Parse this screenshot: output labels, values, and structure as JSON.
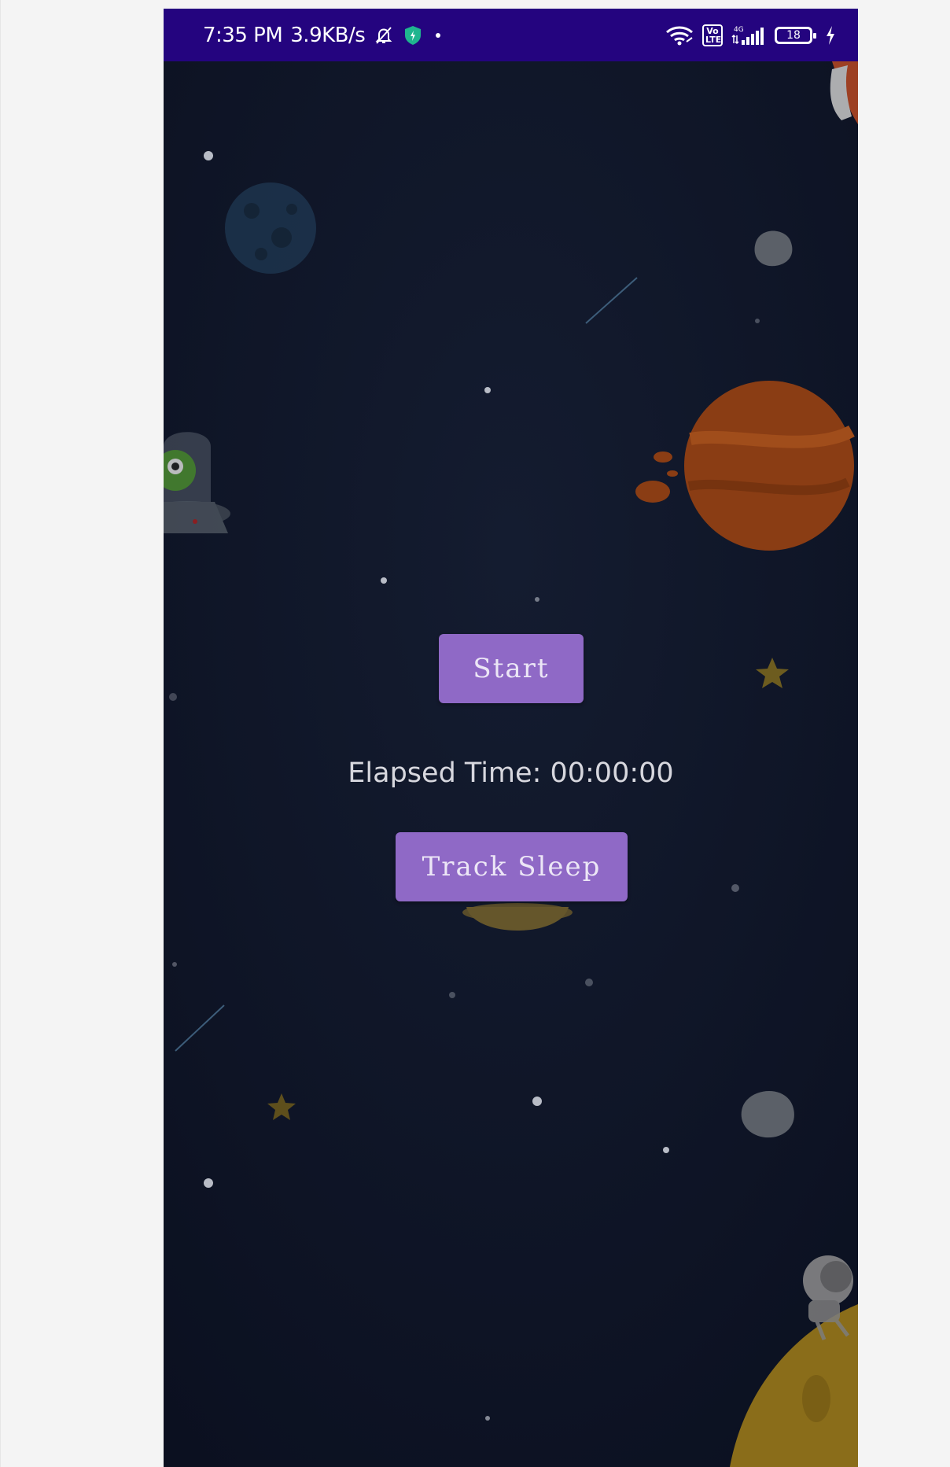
{
  "status_bar": {
    "time": "7:35 PM",
    "speed": "3.9KB/s",
    "network_label": "4G",
    "volte_label": "Vo\nLTE",
    "battery_level": "18",
    "colors": {
      "background": "#24047f",
      "shield": "#1fb58f"
    },
    "icons": [
      "mute-bell-icon",
      "shield-icon",
      "dot-icon",
      "wifi-icon",
      "volte-icon",
      "signal-icon",
      "battery-icon",
      "charging-bolt-icon"
    ]
  },
  "main": {
    "start_label": "Start",
    "elapsed_text": "Elapsed Time: 00:00:00",
    "track_label": "Track Sleep",
    "colors": {
      "button": "#8f69c6",
      "background": "#0e1526"
    }
  }
}
